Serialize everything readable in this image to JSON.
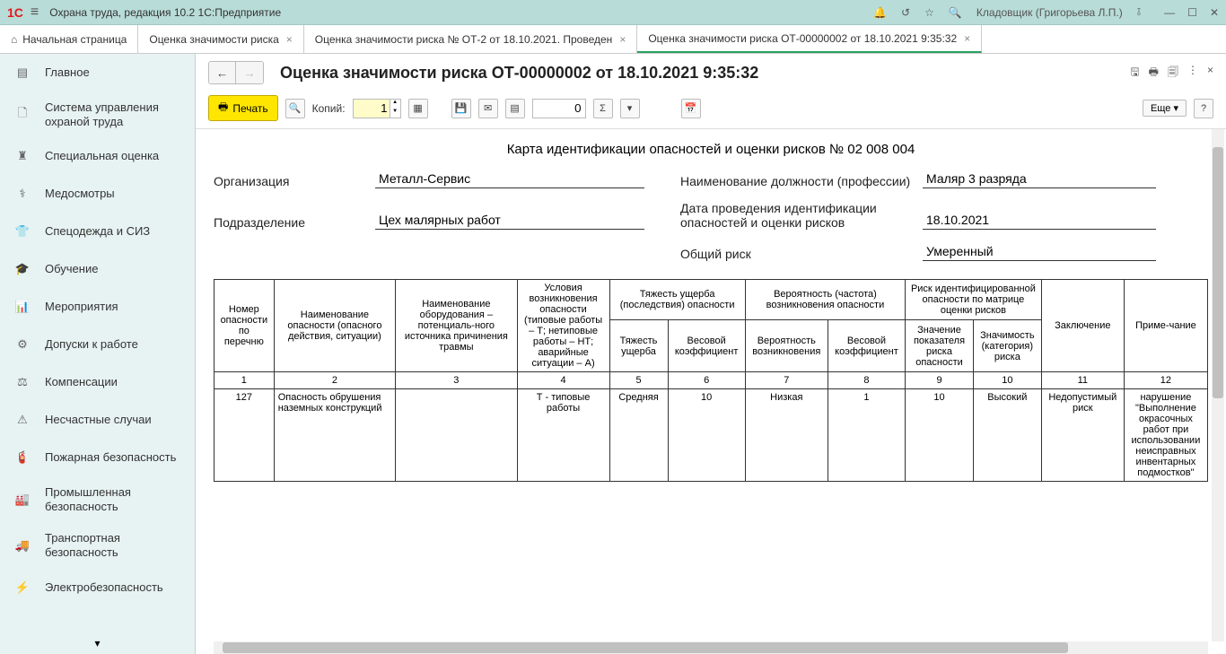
{
  "titlebar": {
    "logo": "1C",
    "title": "Охрана труда, редакция 10.2 1С:Предприятие",
    "user": "Кладовщик (Григорьева Л.П.)"
  },
  "tabs": {
    "home": "Начальная страница",
    "t1": "Оценка значимости риска",
    "t2": "Оценка значимости риска № ОТ-2 от 18.10.2021. Проведен",
    "t3": "Оценка значимости риска ОТ-00000002 от 18.10.2021 9:35:32"
  },
  "sidebar": {
    "items": [
      {
        "label": "Главное"
      },
      {
        "label": "Система управления охраной труда"
      },
      {
        "label": "Специальная оценка"
      },
      {
        "label": "Медосмотры"
      },
      {
        "label": "Спецодежда и СИЗ"
      },
      {
        "label": "Обучение"
      },
      {
        "label": "Мероприятия"
      },
      {
        "label": "Допуски к работе"
      },
      {
        "label": "Компенсации"
      },
      {
        "label": "Несчастные случаи"
      },
      {
        "label": "Пожарная безопасность"
      },
      {
        "label": "Промышленная безопасность"
      },
      {
        "label": "Транспортная безопасность"
      },
      {
        "label": "Электробезопасность"
      }
    ]
  },
  "doc": {
    "title": "Оценка значимости риска ОТ-00000002 от 18.10.2021 9:35:32",
    "card_title": "Карта идентификации опасностей и оценки рисков № 02 008 004",
    "print": "Печать",
    "copies": "Копий:",
    "copies_val": "1",
    "numval": "0",
    "more": "Еще",
    "help": "?",
    "org_label": "Организация",
    "org_value": "Металл-Сервис",
    "dept_label": "Подразделение",
    "dept_value": "Цех малярных работ",
    "post_label": "Наименование должности (профессии)",
    "post_value": "Маляр 3 разряда",
    "date_label": "Дата проведения идентификации опасностей и оценки рисков",
    "date_value": "18.10.2021",
    "risk_label": "Общий риск",
    "risk_value": "Умеренный"
  },
  "table": {
    "headers": {
      "c1": "Номер опасности по перечню",
      "c2": "Наименование опасности (опасного действия, ситуации)",
      "c3": "Наименование оборудования – потенциаль-ного источника причинения травмы",
      "c4": "Условия возникновения опасности (типовые работы – Т; нетиповые работы – НТ; аварийные ситуации – А)",
      "c5g": "Тяжесть ущерба (последствия) опасности",
      "c5a": "Тяжесть ущерба",
      "c5b": "Весовой коэффициент",
      "c6g": "Вероятность (частота) возникновения опасности",
      "c6a": "Вероятность возникновения",
      "c6b": "Весовой коэффициент",
      "c7g": "Риск идентифицированной опасности по матрице оценки рисков",
      "c7a": "Значение показателя риска опасности",
      "c7b": "Значимость (категория) риска",
      "c8": "Заключение",
      "c9": "Приме-чание"
    },
    "nums": [
      "1",
      "2",
      "3",
      "4",
      "5",
      "6",
      "7",
      "8",
      "9",
      "10",
      "11",
      "12"
    ],
    "row": {
      "c1": "127",
      "c2": "Опасность обрушения наземных конструкций",
      "c3": "",
      "c4": "Т - типовые работы",
      "c5a": "Средняя",
      "c5b": "10",
      "c6a": "Низкая",
      "c6b": "1",
      "c7a": "10",
      "c7b": "Высокий",
      "c8": "Недопустимый риск",
      "c9": "нарушение \"Выполнение окрасочных работ при использовании неисправных инвентарных подмостков\""
    }
  }
}
